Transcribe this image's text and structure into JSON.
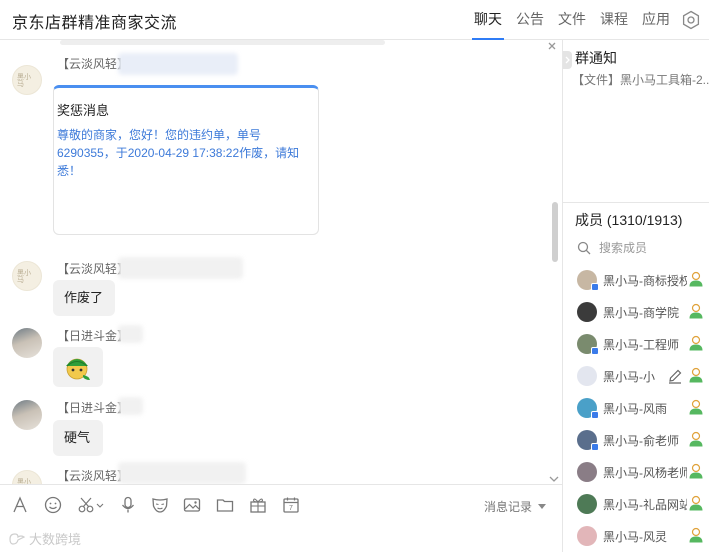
{
  "header": {
    "title": "京东店群精准商家交流",
    "tabs": [
      "聊天",
      "公告",
      "文件",
      "课程",
      "应用"
    ],
    "active_tab": "聊天"
  },
  "chat": {
    "messages": [
      {
        "sender": "【云淡风轻】",
        "card": {
          "title": "奖惩消息",
          "body": "尊敬的商家，您好！您的违约单，单号6290355，于2020-04-29 17:38:22作废，请知悉！"
        }
      },
      {
        "sender": "【云淡风轻】",
        "text": "作废了"
      },
      {
        "sender": "【日进斗金】",
        "sticker": "turtle-emoji"
      },
      {
        "sender": "【日进斗金】",
        "text": "硬气"
      },
      {
        "sender": "【云淡风轻】"
      }
    ]
  },
  "toolbar": {
    "tools": [
      "font-icon",
      "emoji-icon",
      "scissors-icon",
      "microphone-icon",
      "mask-icon",
      "image-icon",
      "folder-icon",
      "gift-icon",
      "calendar-icon"
    ],
    "history_label": "消息记录"
  },
  "watermark": "大数跨境",
  "side": {
    "notice_title": "群通知",
    "notice_item": "【文件】黑小马工具箱-2...",
    "members_title": "成员 (1310/1913)",
    "search_placeholder": "搜索成员",
    "members": [
      {
        "name": "黑小马-商标授权",
        "color": "#c7b7a3"
      },
      {
        "name": "黑小马-商学院",
        "color": "#3b3b3b"
      },
      {
        "name": "黑小马-工程师",
        "color": "#7a8b6e"
      },
      {
        "name": "黑小马-小",
        "color": "#e3e6ef"
      },
      {
        "name": "黑小马-风雨",
        "color": "#4aa0c8"
      },
      {
        "name": "黑小马-俞老师",
        "color": "#5a6e8c"
      },
      {
        "name": "黑小马-风杨老师",
        "color": "#8a7d86"
      },
      {
        "name": "黑小马-礼品网站",
        "color": "#4e7a56"
      },
      {
        "name": "黑小马-风灵",
        "color": "#e2b6b9"
      }
    ]
  },
  "colors": {
    "accent": "#2f7cf6",
    "link_blue": "#3d7ad9",
    "user_green": "#56b860"
  }
}
